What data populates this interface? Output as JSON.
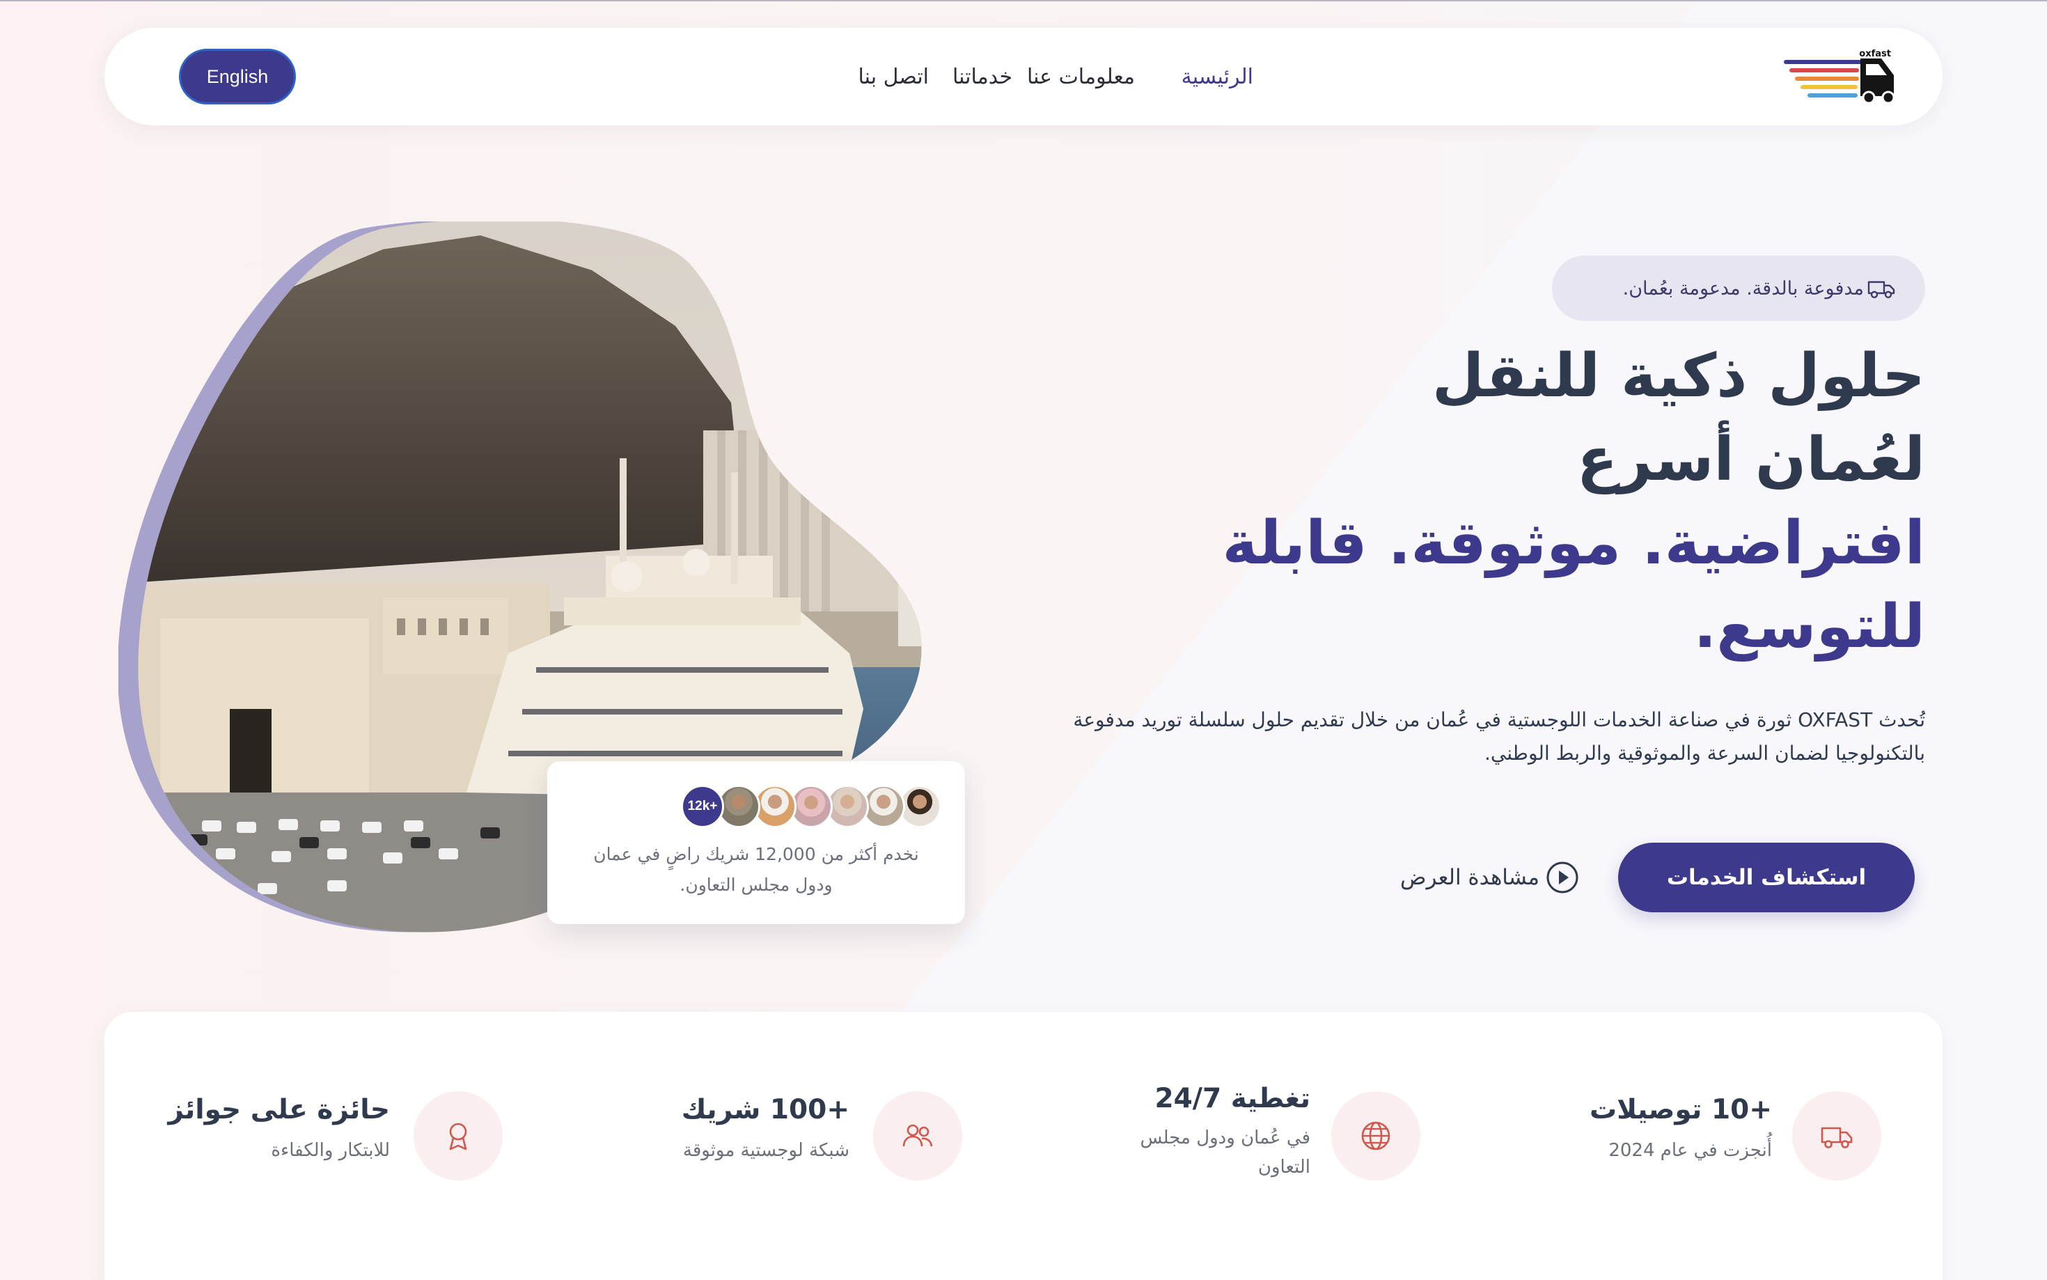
{
  "brand": {
    "logo_text": "oxfast"
  },
  "nav": {
    "home": "الرئيسية",
    "about": "معلومات عنا",
    "services": "خدماتنا",
    "contact": "اتصل بنا",
    "language_button": "English"
  },
  "hero": {
    "badge_text": "مدفوعة بالدقة. مدعومة بعُمان.",
    "headline_line1": "حلول ذكية للنقل",
    "headline_line2": "لعُمان أسرع",
    "headline_line3": "افتراضية. موثوقة. قابلة",
    "headline_line4": "للتوسع.",
    "description": "تُحدث OXFAST ثورة في صناعة الخدمات اللوجستية في عُمان من خلال تقديم حلول سلسلة توريد مدفوعة بالتكنولوجيا لضمان السرعة والموثوقية والربط الوطني.",
    "cta_primary": "استكشاف الخدمات",
    "cta_secondary": "مشاهدة العرض"
  },
  "partners_card": {
    "count_badge": "+12k",
    "text": "نخدم أكثر من 12,000 شريك راضٍ في عمان ودول مجلس التعاون."
  },
  "stats": [
    {
      "title": "+10 توصيلات",
      "subtitle": "أُنجزت في عام 2024",
      "icon": "truck-icon"
    },
    {
      "title": "تغطية 24/7",
      "subtitle": "في عُمان ودول مجلس التعاون",
      "icon": "globe-icon"
    },
    {
      "title": "+100 شريك",
      "subtitle": "شبكة لوجستية موثوقة",
      "icon": "users-icon"
    },
    {
      "title": "حائزة على جوائز",
      "subtitle": "للابتكار والكفاءة",
      "icon": "award-icon"
    }
  ],
  "colors": {
    "primary": "#3d3a8d",
    "heading": "#2f3a4f",
    "accent_icon": "#d0574e",
    "icon_bg": "#fbeeee"
  }
}
